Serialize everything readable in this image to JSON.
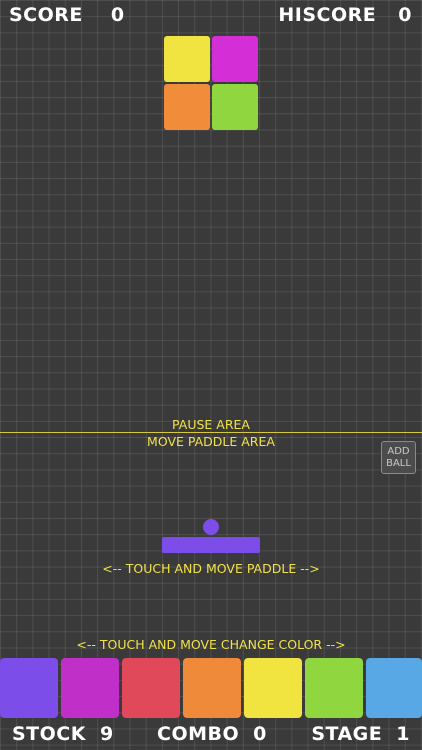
{
  "hud": {
    "score_label": "SCORE",
    "score_value": "0",
    "hiscore_label": "HISCORE",
    "hiscore_value": "0",
    "stock_label": "STOCK",
    "stock_value": "9",
    "combo_label": "COMBO",
    "combo_value": "0",
    "stage_label": "STAGE",
    "stage_value": "1"
  },
  "falling_piece": {
    "colors": [
      "#f1e440",
      "#d42fd6",
      "#f08c3a",
      "#8fd63f"
    ]
  },
  "guides": {
    "pause_area": "PAUSE AREA",
    "move_paddle_area": "MOVE PADDLE AREA",
    "touch_move_paddle": "<-- TOUCH AND MOVE PADDLE -->",
    "touch_move_color": "<-- TOUCH AND MOVE CHANGE COLOR -->"
  },
  "add_ball": {
    "line1": "ADD",
    "line2": "BALL"
  },
  "paddle": {
    "color": "#7c4de8"
  },
  "palette": {
    "colors": [
      "#7c4de8",
      "#c02fc7",
      "#e0495a",
      "#ef8a3a",
      "#f1e440",
      "#8fd63f",
      "#58a8e6"
    ]
  }
}
